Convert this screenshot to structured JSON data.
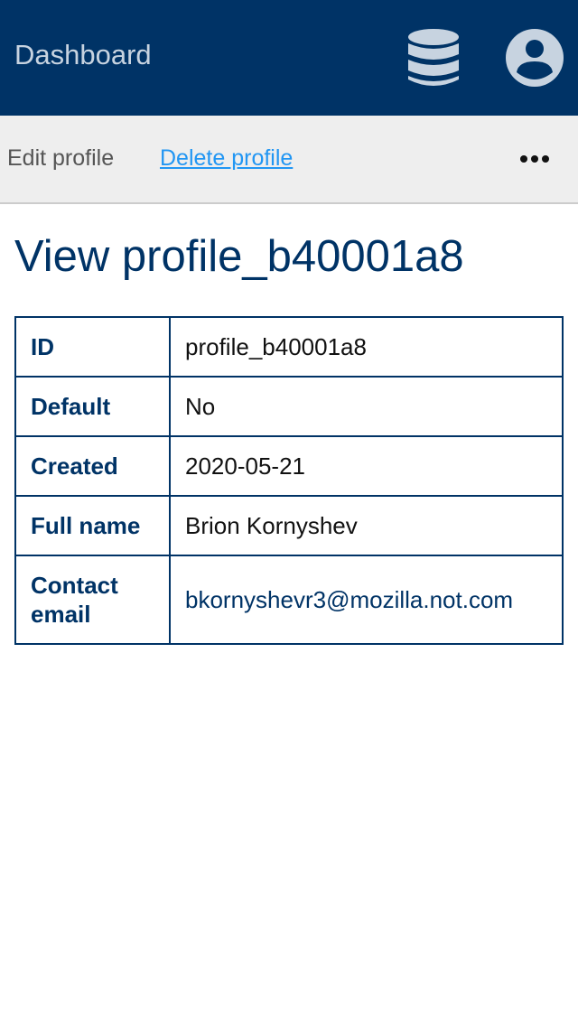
{
  "header": {
    "title": "Dashboard",
    "icons": [
      "database-icon",
      "user-account-icon"
    ],
    "background_color": "#003366"
  },
  "toolbar": {
    "edit_label": "Edit profile",
    "delete_label": "Delete profile",
    "more_icon": "more-horizontal-icon"
  },
  "main": {
    "title": "View profile_b40001a8",
    "details": [
      {
        "label": "ID",
        "value": "profile_b40001a8"
      },
      {
        "label": "Default",
        "value": "No"
      },
      {
        "label": "Created",
        "value": "2020-05-21"
      },
      {
        "label": "Full name",
        "value": "Brion Kornyshev"
      },
      {
        "label": "Contact email",
        "value": "bkornyshevr3@mozilla.not.com"
      }
    ]
  },
  "colors": {
    "accent": "#003366",
    "link": "#2196f3",
    "toolbar_bg": "#eeeeee"
  }
}
